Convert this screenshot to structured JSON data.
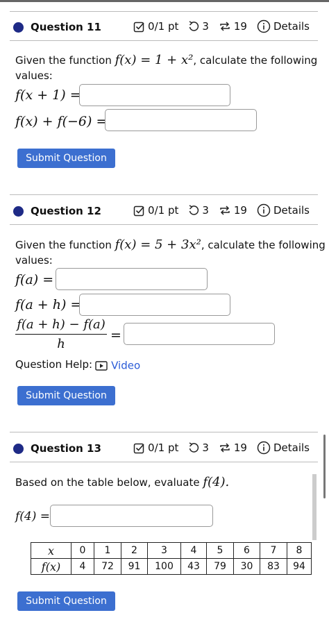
{
  "questions": [
    {
      "title": "Question 11",
      "points": "0/1 pt",
      "tries": "3",
      "retries": "19",
      "details": "Details",
      "prompt_prefix": "Given the function",
      "prompt_suffix": ", calculate the following",
      "prompt_line2": "values:",
      "function": "f(x) = 1 + x²",
      "parts": [
        "f(x + 1) =",
        "f(x) + f(−6) ="
      ],
      "submit": "Submit Question"
    },
    {
      "title": "Question 12",
      "points": "0/1 pt",
      "tries": "3",
      "retries": "19",
      "details": "Details",
      "prompt_prefix": "Given the function",
      "prompt_suffix": ", calculate the following",
      "prompt_line2": "values:",
      "function": "f(x) = 5 + 3x²",
      "parts": [
        "f(a) =",
        "f(a + h) ="
      ],
      "fraction_num": "f(a + h) − f(a)",
      "fraction_den": "h",
      "fraction_eq": "=",
      "help_label": "Question Help:",
      "help_link": "Video",
      "submit": "Submit Question"
    },
    {
      "title": "Question 13",
      "points": "0/1 pt",
      "tries": "3",
      "retries": "19",
      "details": "Details",
      "prompt": "Based on the table below, evaluate",
      "prompt_math": "f(4).",
      "part": "f(4) =",
      "table": {
        "row_headers": [
          "x",
          "f(x)"
        ],
        "x": [
          "0",
          "1",
          "2",
          "3",
          "4",
          "5",
          "6",
          "7",
          "8"
        ],
        "fx": [
          "4",
          "72",
          "91",
          "100",
          "43",
          "79",
          "30",
          "83",
          "94"
        ]
      },
      "submit": "Submit Question"
    }
  ],
  "colors": {
    "accent": "#3c6fd0",
    "dot": "#1e2a86",
    "link": "#2a5bd7"
  }
}
